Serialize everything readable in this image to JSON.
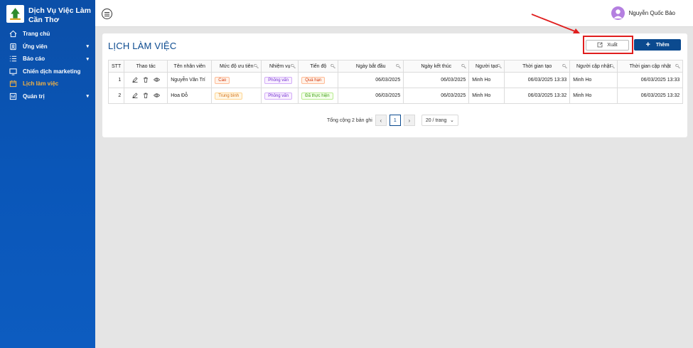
{
  "app": {
    "brand_line1": "Dịch Vụ Việc Làm",
    "brand_line2": "Cần Thơ"
  },
  "sidebar": {
    "items": [
      {
        "label": "Trang chủ",
        "icon": "home-icon",
        "chevron": ""
      },
      {
        "label": "Ứng viên",
        "icon": "user-icon",
        "chevron": "▾"
      },
      {
        "label": "Báo cáo",
        "icon": "list-icon",
        "chevron": "▾"
      },
      {
        "label": "Chiến dịch marketing",
        "icon": "monitor-icon",
        "chevron": ""
      },
      {
        "label": "Lịch làm việc",
        "icon": "calendar-icon",
        "chevron": "",
        "active": true
      },
      {
        "label": "Quản trị",
        "icon": "admin-icon",
        "chevron": "▾"
      }
    ]
  },
  "topbar": {
    "user_name": "Nguyễn Quốc Bảo"
  },
  "page": {
    "title": "LỊCH LÀM VIỆC",
    "export_label": "Xuất",
    "add_label": "Thêm"
  },
  "table": {
    "headers": [
      "STT",
      "Thao tác",
      "Tên nhân viên",
      "Mức độ ưu tiên",
      "Nhiệm vụ",
      "Tiến độ",
      "Ngày bắt đầu",
      "Ngày kết thúc",
      "Người tạo",
      "Thời gian tạo",
      "Người cập nhật",
      "Thời gian cập nhật"
    ],
    "rows": [
      {
        "stt": "1",
        "name": "Nguyễn Văn Trí",
        "priority": "Cao",
        "task": "Phỏng vấn",
        "progress": "Quá hạn",
        "start": "06/03/2025",
        "end": "06/03/2025",
        "creator": "Minh Ho",
        "created": "06/03/2025 13:33",
        "updater": "Minh Ho",
        "updated": "06/03/2025 13:33"
      },
      {
        "stt": "2",
        "name": "Hoa Đỗ",
        "priority": "Trung bình",
        "task": "Phỏng vấn",
        "progress": "Đã thực hiện",
        "start": "06/03/2025",
        "end": "06/03/2025",
        "creator": "Minh Ho",
        "created": "06/03/2025 13:32",
        "updater": "Minh Ho",
        "updated": "06/03/2025 13:32"
      }
    ]
  },
  "pagination": {
    "total_text": "Tổng cộng 2 bản ghi",
    "current_page": "1",
    "page_size": "20 / trang"
  },
  "colors": {
    "primary": "#0b4a8f",
    "sidebar": "#0b4fa8",
    "highlight": "#e01e1e",
    "active_menu": "#f5b342"
  }
}
